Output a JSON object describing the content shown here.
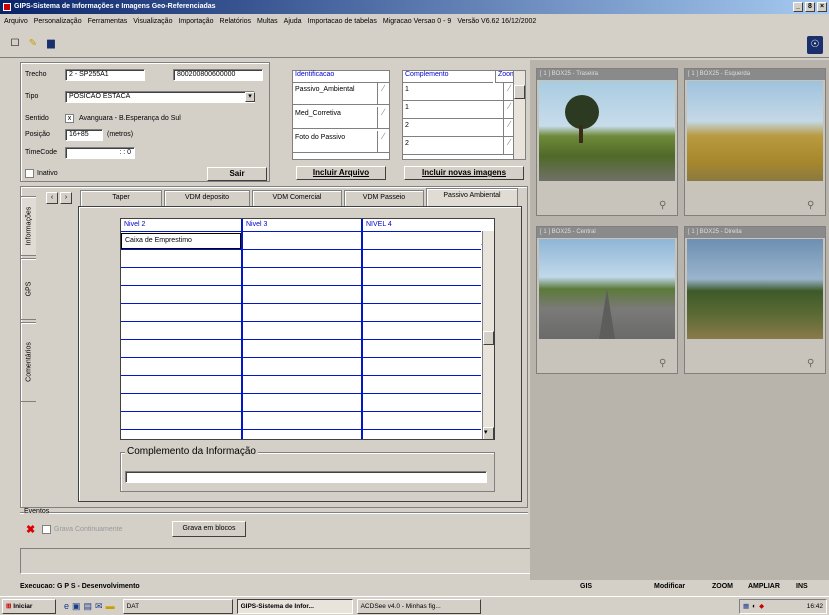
{
  "window": {
    "title": "GIPS-Sistema de Informações e Imagens Geo-Referenciadas",
    "buttons": [
      "_",
      "8",
      "×"
    ]
  },
  "menu": [
    "Arquivo",
    "Personalização",
    "Ferramentas",
    "Visualização",
    "Importação",
    "Relatórios",
    "Multas",
    "Ajuda",
    "Importacao de tabelas",
    "Migracao Versao 0 - 9",
    "Versão V6.62 16/12/2002"
  ],
  "form": {
    "trecho_label": "Trecho",
    "trecho_value": "2 - SP255A1",
    "trecho_code": "800200800600000",
    "tipo_label": "Tipo",
    "tipo_value": "POSICAO ESTACA",
    "sentido_label": "Sentido",
    "sentido_value": "Avanguara - B.Esperança do Sul",
    "sentido_check": "x",
    "posicao_label": "Posição",
    "posicao_value": "16+85",
    "posicao_unit": "(metros)",
    "timecode_label": "TimeCode",
    "timecode_value": ": : 0",
    "inativo_label": "Inativo",
    "sair_label": "Sair"
  },
  "identificacao": {
    "header": "Identificacao",
    "items": [
      "Passivo_Ambiental",
      "Med_Corretiva",
      "Foto do Passivo"
    ],
    "button": "Incluir Arquivo"
  },
  "complemento": {
    "header": "Complemento",
    "zoom_header": "Zoom",
    "items": [
      "1",
      "1",
      "2",
      "2"
    ],
    "button": "Incluir novas imagens"
  },
  "tabs": [
    "Taper",
    "VDM deposito",
    "VDM Comercial",
    "VDM Passeio",
    "Passivo Ambiental"
  ],
  "side_tabs": [
    "Informações",
    "GPS",
    "Comentários"
  ],
  "grid": {
    "headers": [
      "Nivel 2",
      "Nivel 3",
      "NIVEL 4"
    ],
    "first_row": "Caixa de Emprestimo"
  },
  "complemento_info_label": "Complemento da Informação",
  "eventos": {
    "label": "Eventos",
    "grava_label": "Grava Continuamente",
    "button": "Grava em blocos"
  },
  "photos": [
    {
      "caption": "[ 1 ] BOX25 - Traseira"
    },
    {
      "caption": "[ 1 ] BOX25 - Esquerda"
    },
    {
      "caption": "[ 1 ] BOX25 - Central"
    },
    {
      "caption": "[ 1 ] BOX25 - Direita"
    }
  ],
  "status": {
    "left": "Execucao: G P S - Desenvolvimento",
    "app": "GIS",
    "modificar": "Modificar",
    "zoom": "ZOOM",
    "ampliar": "AMPLIAR",
    "ins": "INS"
  },
  "taskbar": {
    "start": "Iniciar",
    "items": [
      "DAT",
      "GIPS-Sistema de Infor...",
      "ACDSee v4.0 - Minhas fig..."
    ],
    "clock": "16:42"
  }
}
